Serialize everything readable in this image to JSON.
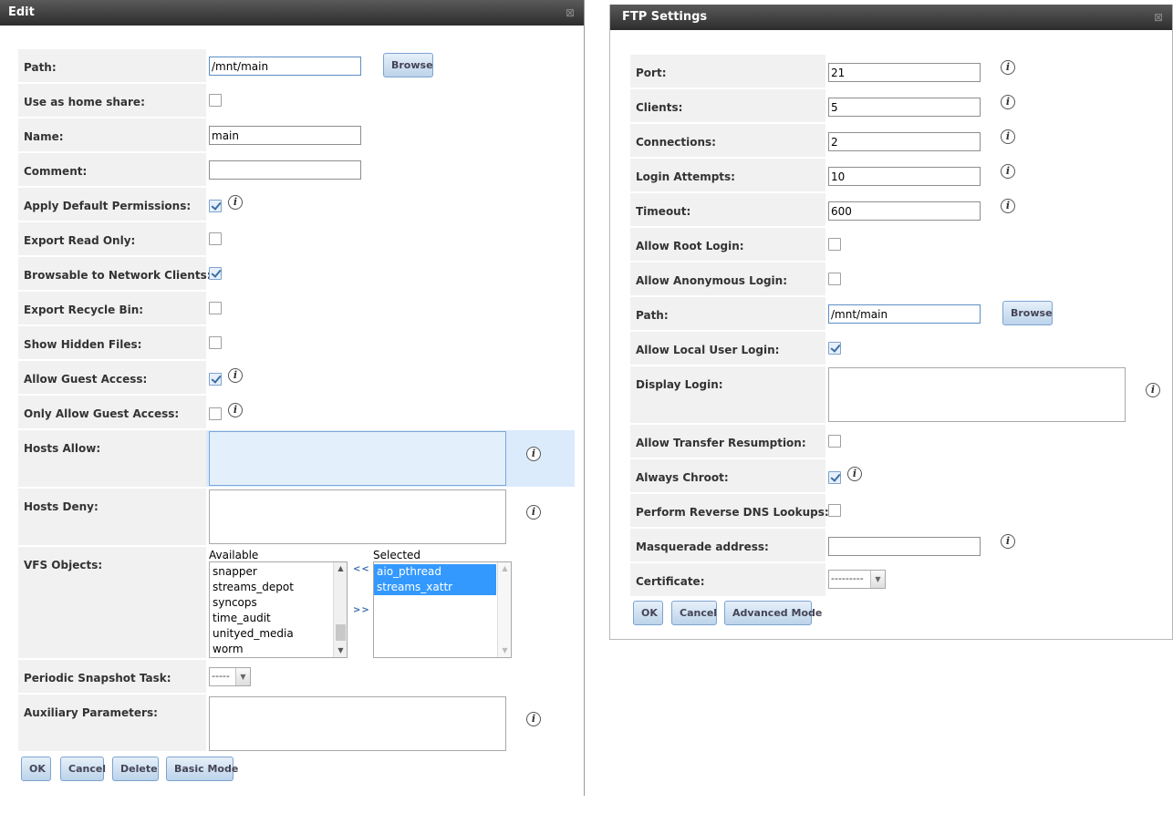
{
  "edit": {
    "title": "Edit",
    "path": {
      "label": "Path:",
      "value": "/mnt/main",
      "browse": "Browse"
    },
    "home_share": {
      "label": "Use as home share:"
    },
    "name": {
      "label": "Name:",
      "value": "main"
    },
    "comment": {
      "label": "Comment:",
      "value": ""
    },
    "default_perms": {
      "label": "Apply Default Permissions:",
      "checked": true
    },
    "read_only": {
      "label": "Export Read Only:",
      "checked": false
    },
    "browsable": {
      "label": "Browsable to Network Clients:",
      "checked": true
    },
    "recycle": {
      "label": "Export Recycle Bin:",
      "checked": false
    },
    "hidden": {
      "label": "Show Hidden Files:",
      "checked": false
    },
    "guest": {
      "label": "Allow Guest Access:",
      "checked": true
    },
    "guest_only": {
      "label": "Only Allow Guest Access:",
      "checked": false
    },
    "hosts_allow": {
      "label": "Hosts Allow:"
    },
    "hosts_deny": {
      "label": "Hosts Deny:"
    },
    "vfs": {
      "label": "VFS Objects:",
      "available_label": "Available",
      "selected_label": "Selected",
      "available": [
        "snapper",
        "streams_depot",
        "syncops",
        "time_audit",
        "unityed_media",
        "worm"
      ],
      "selected": [
        "aio_pthread",
        "streams_xattr"
      ],
      "move_left": "<<",
      "move_right": ">>"
    },
    "snapshot": {
      "label": "Periodic Snapshot Task:",
      "value": "-----"
    },
    "aux": {
      "label": "Auxiliary Parameters:"
    },
    "buttons": {
      "ok": "OK",
      "cancel": "Cancel",
      "delete": "Delete",
      "mode": "Basic Mode"
    }
  },
  "ftp": {
    "title": "FTP Settings",
    "port": {
      "label": "Port:",
      "value": "21"
    },
    "clients": {
      "label": "Clients:",
      "value": "5"
    },
    "connections": {
      "label": "Connections:",
      "value": "2"
    },
    "login_attempts": {
      "label": "Login Attempts:",
      "value": "10"
    },
    "timeout": {
      "label": "Timeout:",
      "value": "600"
    },
    "root_login": {
      "label": "Allow Root Login:"
    },
    "anon_login": {
      "label": "Allow Anonymous Login:"
    },
    "path": {
      "label": "Path:",
      "value": "/mnt/main",
      "browse": "Browse"
    },
    "local_login": {
      "label": "Allow Local User Login:"
    },
    "display_login": {
      "label": "Display Login:"
    },
    "resume": {
      "label": "Allow Transfer Resumption:"
    },
    "chroot": {
      "label": "Always Chroot:"
    },
    "reverse_dns": {
      "label": "Perform Reverse DNS Lookups:"
    },
    "masq": {
      "label": "Masquerade address:",
      "value": ""
    },
    "cert": {
      "label": "Certificate:",
      "value": "---------"
    },
    "buttons": {
      "ok": "OK",
      "cancel": "Cancel",
      "mode": "Advanced Mode"
    }
  },
  "icons": {
    "close": "close-icon",
    "info": "info-icon",
    "checkbox": "checkbox",
    "dropdown": "chevron-down-icon"
  },
  "glyphs": {
    "close": "⊠",
    "info": "i",
    "arrow_up": "▲",
    "arrow_down": "▼"
  }
}
